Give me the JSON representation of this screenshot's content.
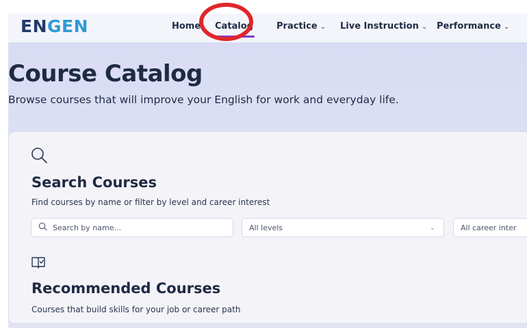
{
  "nav": {
    "logo_en": "EN",
    "logo_gen": "GEN",
    "items": [
      {
        "label": "Home"
      },
      {
        "label": "Catalog"
      },
      {
        "label": "Practice"
      },
      {
        "label": "Live Instruction"
      },
      {
        "label": "Performance"
      }
    ],
    "active": "Catalog",
    "highlight_color": "#e0262b",
    "active_underline_color": "#7d3cc8"
  },
  "page": {
    "title": "Course Catalog",
    "subtitle": "Browse courses that will improve your English for work and everyday life."
  },
  "search": {
    "icon": "search-icon",
    "title": "Search Courses",
    "description": "Find courses by name or filter by level and career interest",
    "placeholder": "Search by name...",
    "level_select": "All levels",
    "career_select": "All career inter"
  },
  "recommended": {
    "icon": "book-check-icon",
    "title": "Recommended Courses",
    "description": "Courses that build skills for your job or career path"
  }
}
